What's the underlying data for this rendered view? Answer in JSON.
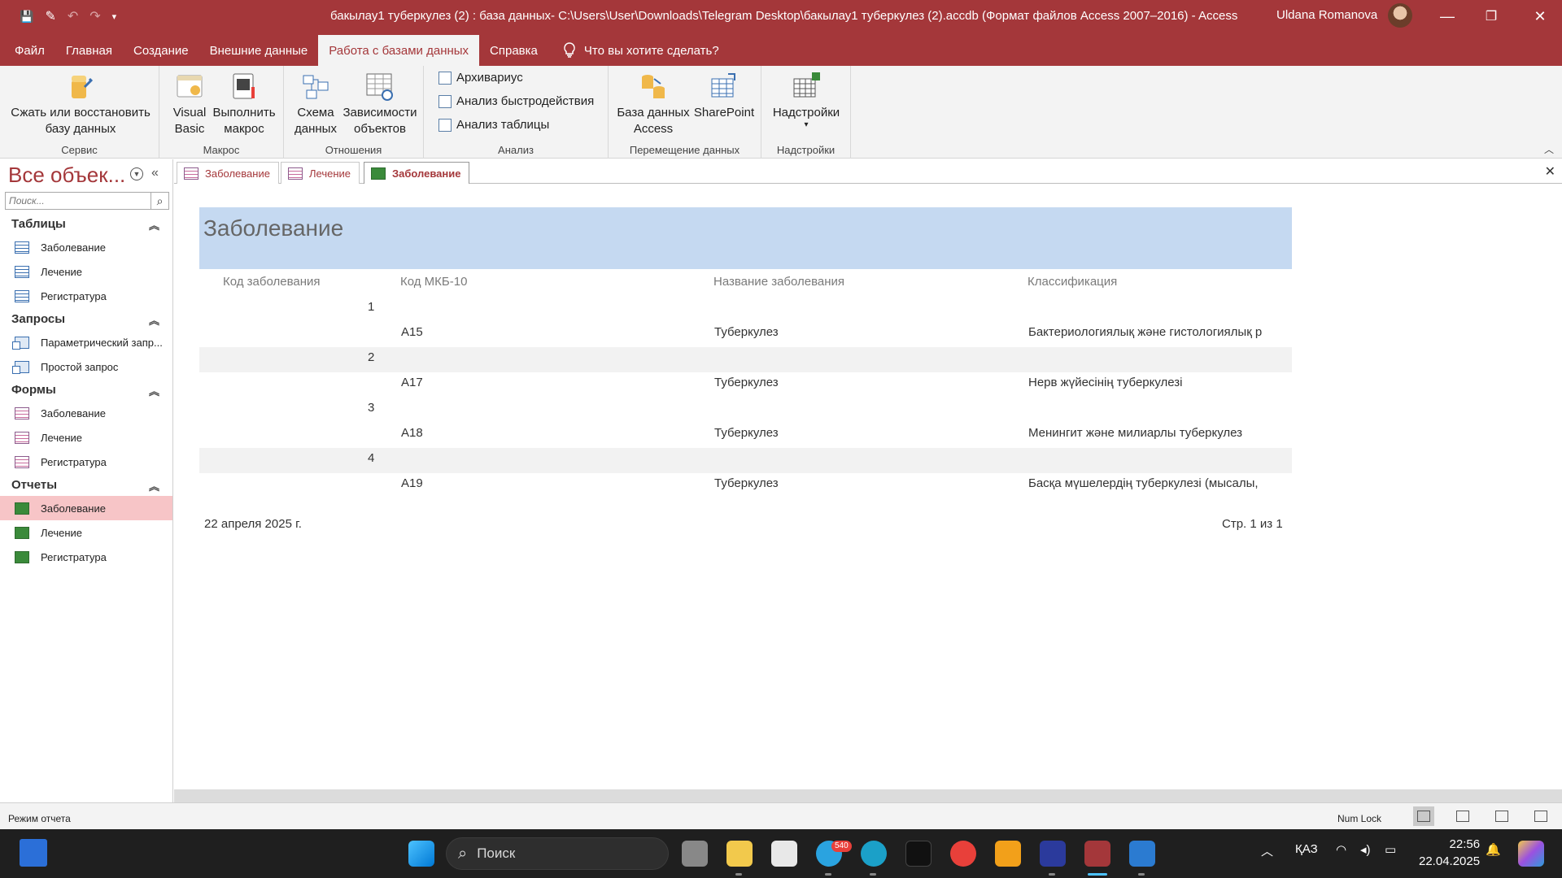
{
  "window": {
    "title": "бакылау1 туберкулез (2) : база данных- C:\\Users\\User\\Downloads\\Telegram Desktop\\бакылау1 туберкулез (2).accdb (Формат файлов Access 2007–2016)  -  Access",
    "user": "Uldana Romanova",
    "minimize": "—",
    "restore": "❐",
    "close": "✕"
  },
  "qat": {
    "save": "💾",
    "touch": "✎",
    "undo": "↶",
    "redo": "↷",
    "customize": "▾"
  },
  "menu": {
    "tabs": [
      "Файл",
      "Главная",
      "Создание",
      "Внешние данные",
      "Работа с базами данных",
      "Справка"
    ],
    "active_index": 4,
    "tell_me": "Что вы хотите сделать?"
  },
  "ribbon": {
    "groups": [
      {
        "label": "Сервис",
        "buttons": [
          {
            "line1": "Сжать или восстановить",
            "line2": "базу данных"
          }
        ]
      },
      {
        "label": "Макрос",
        "buttons": [
          {
            "line1": "Visual",
            "line2": "Basic"
          },
          {
            "line1": "Выполнить",
            "line2": "макрос"
          }
        ]
      },
      {
        "label": "Отношения",
        "buttons": [
          {
            "line1": "Схема",
            "line2": "данных"
          },
          {
            "line1": "Зависимости",
            "line2": "объектов"
          }
        ]
      },
      {
        "label": "Анализ",
        "small": [
          "Архивариус",
          "Анализ быстродействия",
          "Анализ таблицы"
        ]
      },
      {
        "label": "Перемещение данных",
        "buttons": [
          {
            "line1": "База данных",
            "line2": "Access"
          },
          {
            "line1": "SharePoint",
            "line2": ""
          }
        ]
      },
      {
        "label": "Надстройки",
        "buttons": [
          {
            "line1": "Надстройки",
            "line2": "▾"
          }
        ]
      }
    ],
    "collapse": "︿"
  },
  "nav": {
    "header": "Все объек...",
    "search_placeholder": "Поиск...",
    "sections": [
      {
        "title": "Таблицы",
        "type": "table",
        "items": [
          "Заболевание",
          "Лечение",
          "Регистратура"
        ]
      },
      {
        "title": "Запросы",
        "type": "query",
        "items": [
          "Параметрический запр...",
          "Простой запрос"
        ]
      },
      {
        "title": "Формы",
        "type": "form",
        "items": [
          "Заболевание",
          "Лечение",
          "Регистратура"
        ]
      },
      {
        "title": "Отчеты",
        "type": "report",
        "items": [
          "Заболевание",
          "Лечение",
          "Регистратура"
        ]
      }
    ],
    "selected": "Отчеты/Заболевание"
  },
  "doc_tabs": [
    {
      "label": "Заболевание",
      "type": "form"
    },
    {
      "label": "Лечение",
      "type": "form"
    },
    {
      "label": "Заболевание",
      "type": "report",
      "active": true
    }
  ],
  "report": {
    "title": "Заболевание",
    "columns": [
      "Код заболевания",
      "Код МКБ-10",
      "Название заболевания",
      "Классификация"
    ],
    "rows": [
      {
        "id": "1",
        "mkb": "A15",
        "name": "Туберкулез",
        "class": "Бактериологиялық және гистологиялық р"
      },
      {
        "id": "2",
        "mkb": "A17",
        "name": "Туберкулез",
        "class": "Нерв жүйесінің туберкулезі"
      },
      {
        "id": "3",
        "mkb": "A18",
        "name": "Туберкулез",
        "class": "Менингит және милиарлы туберкулез"
      },
      {
        "id": "4",
        "mkb": "A19",
        "name": "Туберкулез",
        "class": "Басқа мүшелердің туберкулезі (мысалы,"
      }
    ],
    "footer_date": "22 апреля 2025 г.",
    "footer_page": "Стр. 1 из 1"
  },
  "status": {
    "mode": "Режим отчета",
    "numlock": "Num Lock"
  },
  "taskbar": {
    "search": "Поиск",
    "telegram_badge": "540",
    "lang": "ҚАЗ",
    "time": "22:56",
    "date": "22.04.2025"
  },
  "colors": {
    "accent": "#a4373a",
    "report_header": "#c5d9f1",
    "selected_nav": "#f7c5c7"
  }
}
